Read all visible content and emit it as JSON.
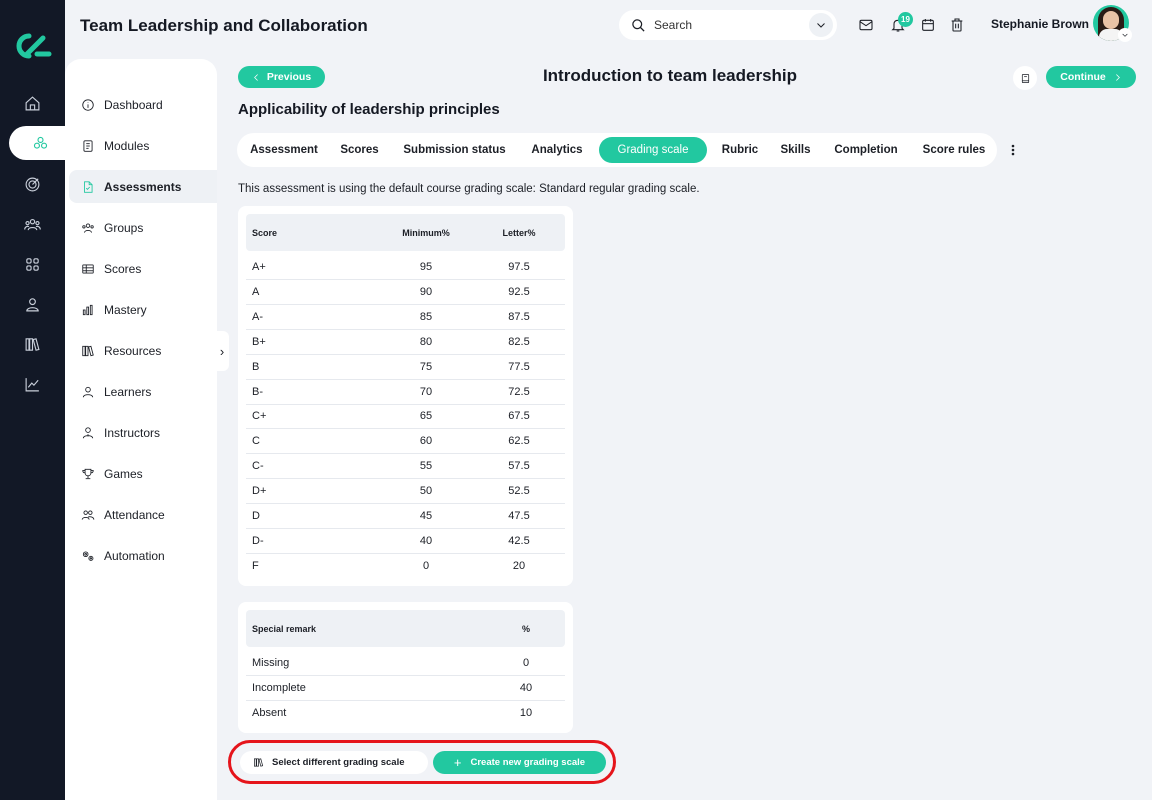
{
  "app": {
    "title": "Team Leadership and Collaboration"
  },
  "topbar": {
    "search_label": "Search",
    "notification_count": "19",
    "user_name": "Stephanie Brown"
  },
  "rail": {
    "items": [
      "home-icon",
      "courses-icon",
      "target-icon",
      "people-icon",
      "apps-icon",
      "user-icon",
      "library-icon",
      "chart-icon"
    ],
    "active_index": 1
  },
  "sidebar": {
    "items": [
      {
        "label": "Dashboard",
        "icon": "info-icon"
      },
      {
        "label": "Modules",
        "icon": "document-icon"
      },
      {
        "label": "Assessments",
        "icon": "assessment-icon"
      },
      {
        "label": "Groups",
        "icon": "groups-icon"
      },
      {
        "label": "Scores",
        "icon": "table-icon"
      },
      {
        "label": "Mastery",
        "icon": "bars-icon"
      },
      {
        "label": "Resources",
        "icon": "books-icon"
      },
      {
        "label": "Learners",
        "icon": "learner-icon"
      },
      {
        "label": "Instructors",
        "icon": "instructor-icon"
      },
      {
        "label": "Games",
        "icon": "trophy-icon"
      },
      {
        "label": "Attendance",
        "icon": "attendance-icon"
      },
      {
        "label": "Automation",
        "icon": "gears-icon"
      }
    ],
    "active_index": 2
  },
  "page": {
    "previous_label": "Previous",
    "title": "Introduction to team leadership",
    "continue_label": "Continue",
    "section_title": "Applicability of leadership principles"
  },
  "tabs": {
    "items": [
      "Assessment",
      "Scores",
      "Submission status",
      "Analytics",
      "Grading scale",
      "Rubric",
      "Skills",
      "Completion",
      "Score rules"
    ],
    "active_index": 4
  },
  "info_text": "This assessment is using the default course grading scale: Standard regular grading scale.",
  "grading_table": {
    "headers": [
      "Score",
      "Minimum%",
      "Letter%"
    ],
    "rows": [
      [
        "A+",
        "95",
        "97.5"
      ],
      [
        "A",
        "90",
        "92.5"
      ],
      [
        "A-",
        "85",
        "87.5"
      ],
      [
        "B+",
        "80",
        "82.5"
      ],
      [
        "B",
        "75",
        "77.5"
      ],
      [
        "B-",
        "70",
        "72.5"
      ],
      [
        "C+",
        "65",
        "67.5"
      ],
      [
        "C",
        "60",
        "62.5"
      ],
      [
        "C-",
        "55",
        "57.5"
      ],
      [
        "D+",
        "50",
        "52.5"
      ],
      [
        "D",
        "45",
        "47.5"
      ],
      [
        "D-",
        "40",
        "42.5"
      ],
      [
        "F",
        "0",
        "20"
      ]
    ]
  },
  "remarks_table": {
    "headers": [
      "Special remark",
      "%"
    ],
    "rows": [
      [
        "Missing",
        "0"
      ],
      [
        "Incomplete",
        "40"
      ],
      [
        "Absent",
        "10"
      ]
    ]
  },
  "actions": {
    "select_label": "Select different grading scale",
    "create_label": "Create new grading scale",
    "highlight_color": "#e5141b"
  },
  "colors": {
    "accent": "#22c8a0",
    "rail_bg": "#121826",
    "page_bg": "#f1f3f7"
  }
}
